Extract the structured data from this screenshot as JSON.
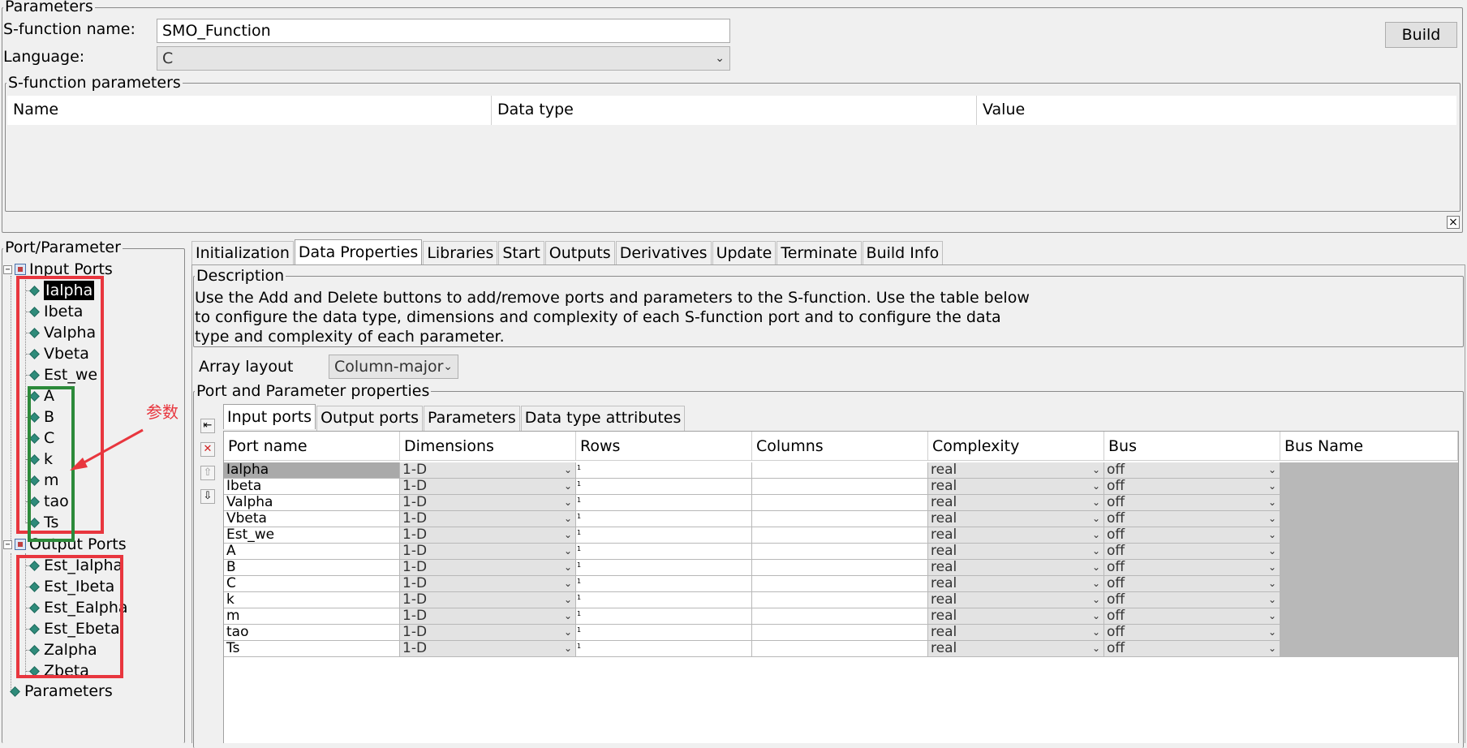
{
  "parameters_group": {
    "legend": "Parameters",
    "sfunction_name_label": "S-function name:",
    "sfunction_name_value": "SMO_Function",
    "language_label": "Language:",
    "language_value": "C",
    "build_label": "Build",
    "sfunction_params_legend": "S-function parameters",
    "params_columns": [
      "Name",
      "Data type",
      "Value"
    ],
    "close_glyph": "×"
  },
  "tree": {
    "legend": "Port/Parameter",
    "input_ports_label": "Input Ports",
    "input_ports": [
      "Ialpha",
      "Ibeta",
      "Valpha",
      "Vbeta",
      "Est_we",
      "A",
      "B",
      "C",
      "k",
      "m",
      "tao",
      "Ts"
    ],
    "output_ports_label": "Output Ports",
    "output_ports": [
      "Est_Ialpha",
      "Est_Ibeta",
      "Est_Ealpha",
      "Est_Ebeta",
      "Zalpha",
      "Zbeta"
    ],
    "parameters_label": "Parameters",
    "selected": "Ialpha",
    "expander_minus": "−",
    "annotation_text": "参数",
    "annotation_colors": {
      "red": "#e8363e",
      "green": "#2c8a3a"
    }
  },
  "tabs": {
    "items": [
      "Initialization",
      "Data Properties",
      "Libraries",
      "Start",
      "Outputs",
      "Derivatives",
      "Update",
      "Terminate",
      "Build Info"
    ],
    "active": "Data Properties"
  },
  "description": {
    "legend": "Description",
    "lines": [
      "Use the Add and Delete buttons to add/remove ports and parameters to the S-function. Use the table below",
      "to configure the data type, dimensions and complexity of each S-function port and to configure the data",
      "type and complexity of each parameter."
    ]
  },
  "array_layout": {
    "label": "Array layout",
    "value": "Column-major"
  },
  "port_props": {
    "legend": "Port and Parameter properties",
    "subtabs": [
      "Input ports",
      "Output ports",
      "Parameters",
      "Data type attributes"
    ],
    "active_subtab": "Input ports",
    "side_buttons": [
      "add-port",
      "delete-port",
      "move-up",
      "move-down"
    ],
    "side_glyphs": {
      "add": "⇤",
      "delete": "✕",
      "up": "⇧",
      "down": "⇩"
    },
    "columns": [
      "Port name",
      "Dimensions",
      "Rows",
      "Columns",
      "Complexity",
      "Bus",
      "Bus Name"
    ],
    "rows": [
      {
        "name": "Ialpha",
        "dims": "1-D",
        "rows": "1",
        "cols": "",
        "complexity": "real",
        "bus": "off",
        "bus_name": ""
      },
      {
        "name": "Ibeta",
        "dims": "1-D",
        "rows": "1",
        "cols": "",
        "complexity": "real",
        "bus": "off",
        "bus_name": ""
      },
      {
        "name": "Valpha",
        "dims": "1-D",
        "rows": "1",
        "cols": "",
        "complexity": "real",
        "bus": "off",
        "bus_name": ""
      },
      {
        "name": "Vbeta",
        "dims": "1-D",
        "rows": "1",
        "cols": "",
        "complexity": "real",
        "bus": "off",
        "bus_name": ""
      },
      {
        "name": "Est_we",
        "dims": "1-D",
        "rows": "1",
        "cols": "",
        "complexity": "real",
        "bus": "off",
        "bus_name": ""
      },
      {
        "name": "A",
        "dims": "1-D",
        "rows": "1",
        "cols": "",
        "complexity": "real",
        "bus": "off",
        "bus_name": ""
      },
      {
        "name": "B",
        "dims": "1-D",
        "rows": "1",
        "cols": "",
        "complexity": "real",
        "bus": "off",
        "bus_name": ""
      },
      {
        "name": "C",
        "dims": "1-D",
        "rows": "1",
        "cols": "",
        "complexity": "real",
        "bus": "off",
        "bus_name": ""
      },
      {
        "name": "k",
        "dims": "1-D",
        "rows": "1",
        "cols": "",
        "complexity": "real",
        "bus": "off",
        "bus_name": ""
      },
      {
        "name": "m",
        "dims": "1-D",
        "rows": "1",
        "cols": "",
        "complexity": "real",
        "bus": "off",
        "bus_name": ""
      },
      {
        "name": "tao",
        "dims": "1-D",
        "rows": "1",
        "cols": "",
        "complexity": "real",
        "bus": "off",
        "bus_name": ""
      },
      {
        "name": "Ts",
        "dims": "1-D",
        "rows": "1",
        "cols": "",
        "complexity": "real",
        "bus": "off",
        "bus_name": ""
      }
    ]
  }
}
